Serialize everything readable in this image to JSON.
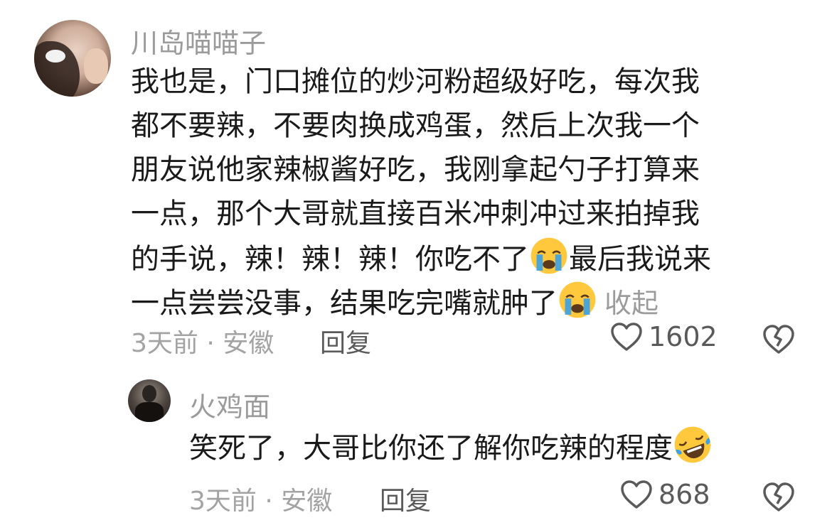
{
  "comment": {
    "username": "川岛喵喵子",
    "content_lines": [
      "我也是，门口摊位的炒河粉超级好吃，每次我",
      "都不要辣，不要肉换成鸡蛋，然后上次我一个",
      "朋友说他家辣椒酱好吃，我刚拿起勺子打算来",
      "一点，那个大哥就直接百米冲刺冲过来拍掉我",
      "的手说，辣！辣！辣！你吃不了",
      "最后我说来",
      "一点尝尝没事，结果吃完嘴就肿了"
    ],
    "collapse_label": "收起",
    "time_location": "3天前 · 安徽",
    "reply_label": "回复",
    "like_count": "1602",
    "emoji": "crying-face-emoji"
  },
  "reply": {
    "username": "火鸡面",
    "content": "笑死了，大哥比你还了解你吃辣的程度",
    "time_location": "3天前 · 安徽",
    "reply_label": "回复",
    "like_count": "868",
    "emoji": "rolling-laughing-emoji"
  },
  "colors": {
    "text": "#1a1a1a",
    "secondary": "#9b9b9b",
    "action": "#5a5a5a",
    "emoji_yellow": "#ffc83d",
    "tear_blue": "#3aa0e8"
  }
}
